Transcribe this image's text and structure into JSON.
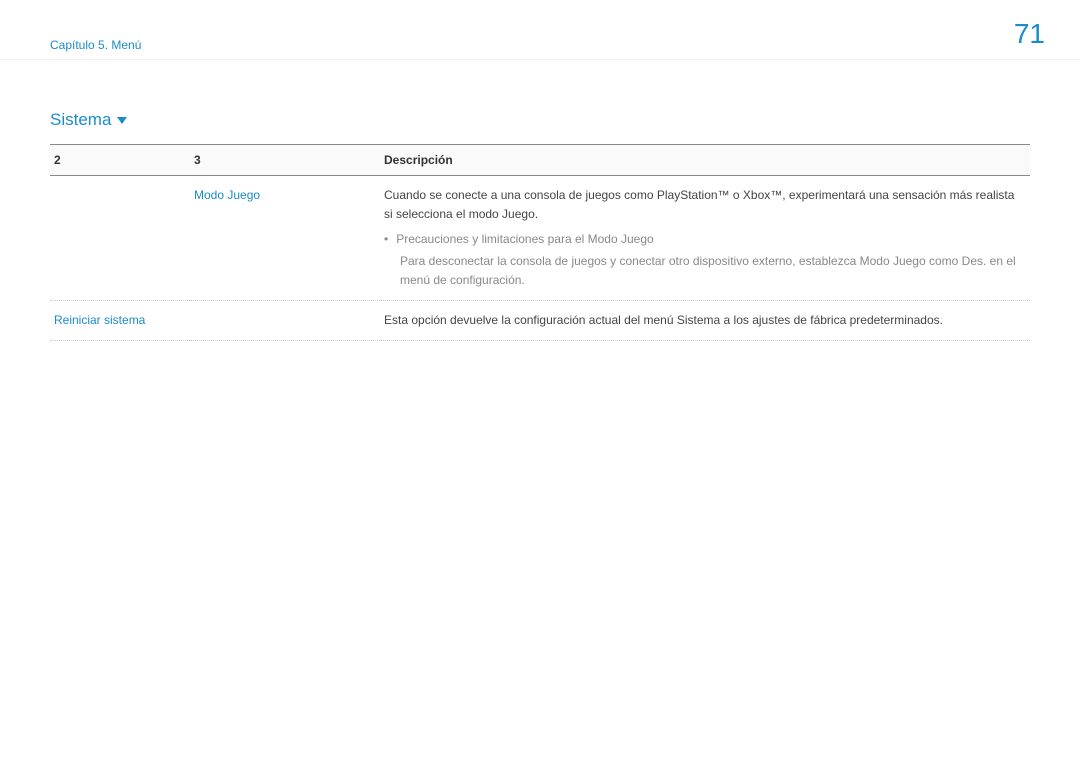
{
  "header": {
    "breadcrumb": "Capítulo 5. Menú",
    "pageNumber": "71"
  },
  "section": {
    "title": "Sistema"
  },
  "table": {
    "headers": {
      "col1": "2",
      "col2": "3",
      "col3": "Descripción"
    },
    "rows": {
      "r0": {
        "col1": "",
        "col2": "Modo Juego",
        "desc_main": "Cuando se conecte a una consola de juegos como PlayStation™ o Xbox™, experimentará una sensación más realista si selecciona el modo Juego.",
        "bullet_title": "Precauciones y limitaciones para el Modo Juego",
        "bullet_detail": "Para desconectar la consola de juegos y conectar otro dispositivo externo, establezca Modo Juego como Des. en el menú de configuración."
      },
      "r1": {
        "col1": "Reiniciar sistema",
        "col2": "",
        "desc_main": "Esta opción devuelve la configuración actual del menú Sistema a los ajustes de fábrica predeterminados."
      }
    }
  }
}
